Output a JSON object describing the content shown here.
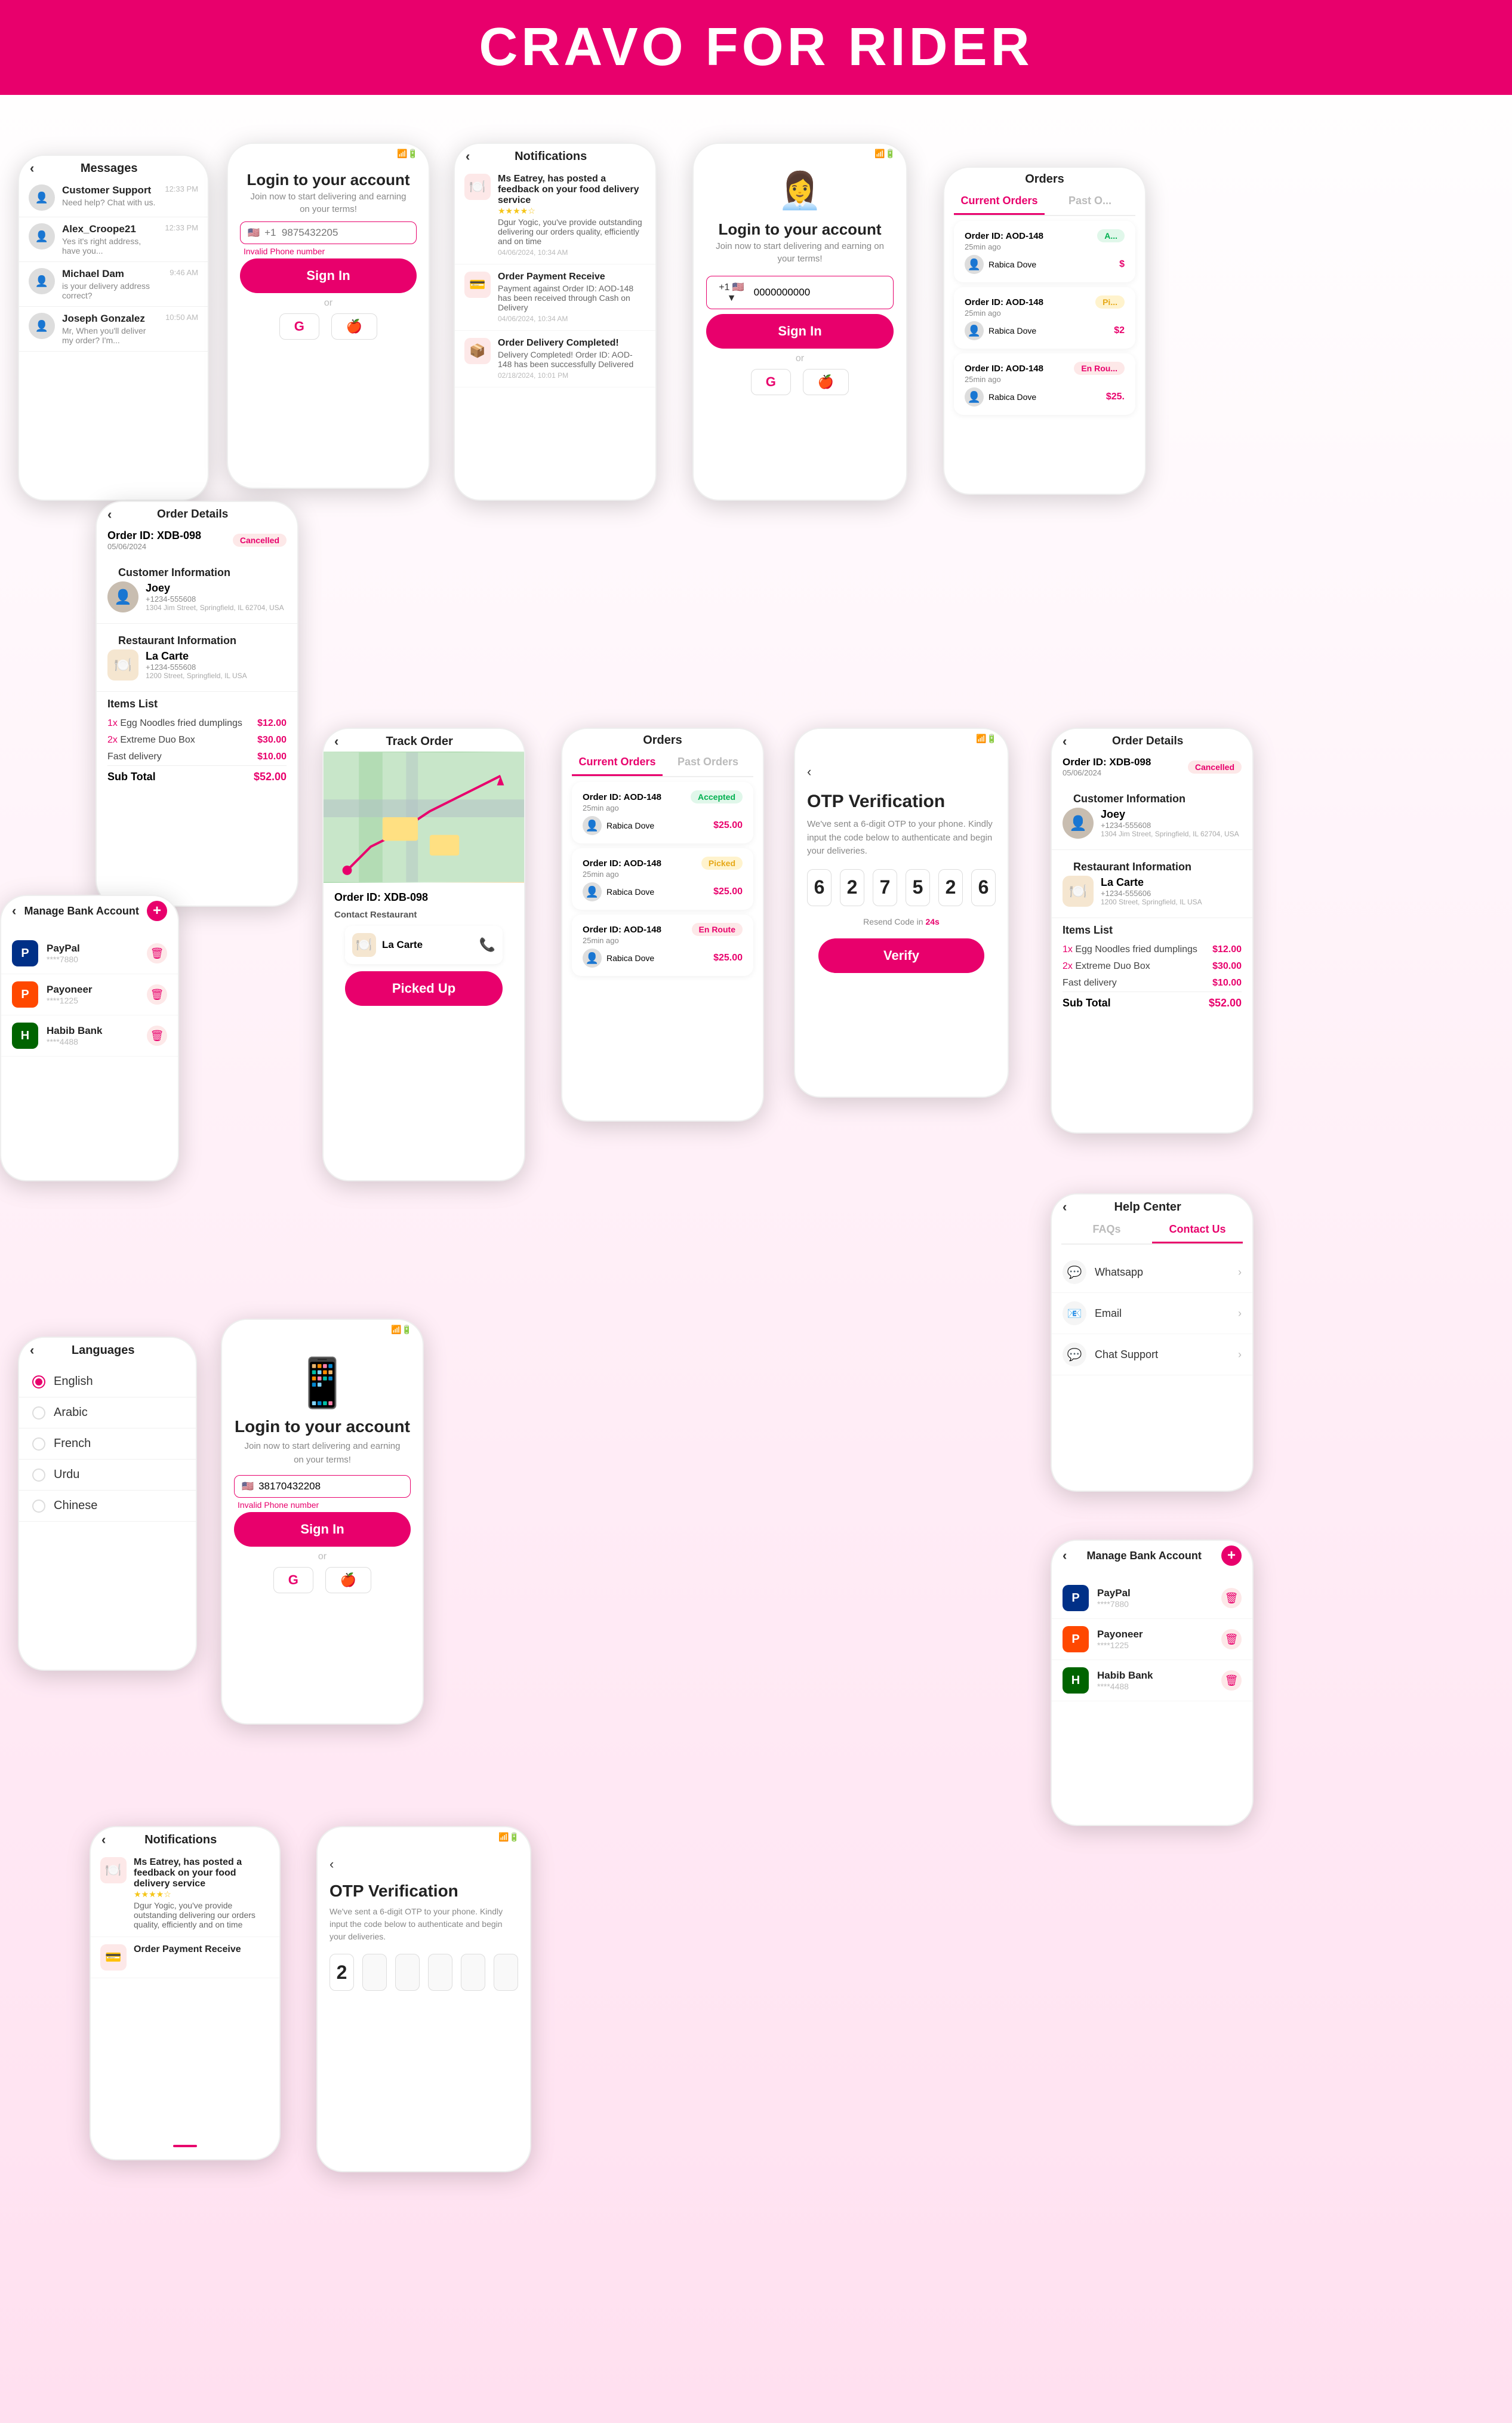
{
  "header": {
    "title": "CRAVO FOR RIDER"
  },
  "screens": {
    "messages": {
      "title": "Messages",
      "items": [
        {
          "name": "Customer Support",
          "text": "Need help? Chat with us.",
          "time": "12:33 PM",
          "avatar": "👤"
        },
        {
          "name": "Alex_Croope21",
          "text": "Yes it's right address, have you...",
          "time": "12:33 PM",
          "avatar": "👤"
        },
        {
          "name": "Michael Dam",
          "text": "is your delivery address correct?",
          "time": "9:46 AM",
          "avatar": "👤"
        },
        {
          "name": "Joseph Gonzalez",
          "text": "Mr, When you'll deliver my order? I'm...",
          "time": "10:50 AM",
          "avatar": "👤"
        }
      ]
    },
    "login1": {
      "title": "Login to your account",
      "subtitle": "Join now to start delivering and earning on your terms!",
      "phone_placeholder": "+1  9875432205",
      "invalid_msg": "Invalid Phone number",
      "sign_in": "Sign In",
      "or": "or",
      "google": "G",
      "apple": ""
    },
    "notifications": {
      "title": "Notifications",
      "items": [
        {
          "icon": "🍽️",
          "title": "Ms Eatrey, has posted a feedback on your food delivery service",
          "stars": 4,
          "text": "Dgur Yogic, you've provide outstanding delivering our orders quality, efficiently and on time",
          "time": "04/06/2024, 10:34 AM"
        },
        {
          "icon": "💳",
          "title": "Order Payment Receive",
          "text": "Payment against Order ID: AOD-148 has been received through Cash on Delivery",
          "time": "04/06/2024, 10:34 AM"
        },
        {
          "icon": "📦",
          "title": "Order Delivery Completed!",
          "text": "Delivery Completed! Order ID: AOD-148 has been successfully Delivered",
          "time": "02/18/2024, 10:01 PM"
        }
      ]
    },
    "login2": {
      "title": "Login to your account",
      "subtitle": "Join now to start delivering and earning on your terms!",
      "phone_placeholder": "0000000000",
      "sign_in": "Sign In",
      "or": "or",
      "google": "G",
      "apple": "",
      "flag": "+1"
    },
    "orders_top": {
      "title": "Orders",
      "tabs": [
        "Current Orders",
        "Past O..."
      ],
      "items": [
        {
          "id": "Order ID: AOD-148",
          "time": "25min ago",
          "customer": "Rabica Dove",
          "price": "$",
          "badge": "A..."
        },
        {
          "id": "Order ID: AOD-148",
          "time": "25min ago",
          "customer": "Rabica Dove",
          "price": "$2",
          "badge": "Pi..."
        },
        {
          "id": "Order ID: AOD-148",
          "time": "25min ago",
          "customer": "Rabica Dove",
          "price": "$25.",
          "badge": "En Rou..."
        }
      ]
    },
    "order_details1": {
      "title": "Order Details",
      "order_id": "Order ID: XDB-098",
      "date": "05/06/2024",
      "badge": "Cancelled",
      "customer_info": "Customer Information",
      "customer_name": "Joey",
      "customer_phone": "+1234-555608",
      "customer_address": "1304 Jim Street, Springfield, IL 62704, USA",
      "restaurant_info": "Restaurant Information",
      "restaurant_name": "La Carte",
      "restaurant_phone": "+1234-555608",
      "restaurant_address": "1200 Street, Springfield, IL USA",
      "items_list": "Items List",
      "items": [
        {
          "qty": "1x",
          "name": "Egg Noodles fried dumplings",
          "price": "$12.00"
        },
        {
          "qty": "2x",
          "name": "Extreme Duo Box",
          "price": "$30.00"
        },
        {
          "name": "Fast delivery",
          "price": "$10.00"
        }
      ],
      "sub_total": "Sub Total",
      "sub_total_price": "$52.00"
    },
    "manage_bank": {
      "title": "Manage Bank Account",
      "accounts": [
        {
          "name": "PayPal",
          "number": "****7880",
          "logo": "P",
          "color": "#003087"
        },
        {
          "name": "Payoneer",
          "number": "****1225",
          "logo": "P",
          "color": "#ff4800"
        },
        {
          "name": "Habib Bank",
          "number": "****4488",
          "logo": "H",
          "color": "#006400"
        }
      ]
    },
    "track_order": {
      "title": "Track Order",
      "order_id": "Order ID: XDB-098",
      "contact_restaurant": "Contact Restaurant",
      "restaurant": "La Carte",
      "picked_up": "Picked Up"
    },
    "orders_mid": {
      "title": "Orders",
      "tabs": [
        "Current Orders",
        "Past Orders"
      ],
      "items": [
        {
          "id": "Order ID: AOD-148",
          "time": "25min ago",
          "customer": "Rabica Dove",
          "price": "$25.00",
          "badge": "Accepted",
          "badge_type": "accepted"
        },
        {
          "id": "Order ID: AOD-148",
          "time": "25min ago",
          "customer": "Rabica Dove",
          "price": "$25.00",
          "badge": "Picked",
          "badge_type": "picked"
        },
        {
          "id": "Order ID: AOD-148",
          "time": "25min ago",
          "customer": "Rabica Dove",
          "price": "$25.00",
          "badge": "En Route",
          "badge_type": "enroute"
        }
      ]
    },
    "otp1": {
      "title": "OTP Verification",
      "desc": "We've sent a 6-digit OTP to your phone. Kindly input the code below to authenticate and begin your deliveries.",
      "digits": [
        "6",
        "2",
        "7",
        "5",
        "2",
        "6"
      ],
      "resend": "Resend Code in",
      "timer": "24s",
      "verify": "Verify"
    },
    "order_details2": {
      "title": "Order Details",
      "order_id": "Order ID: XDB-098",
      "date": "05/06/2024",
      "badge": "Cancelled",
      "customer_name": "Joey",
      "customer_phone": "+1234-555608",
      "customer_address": "1304 Jim Street, Springfield, IL 62704, USA",
      "restaurant_name": "La Carte",
      "restaurant_phone": "+1234-555606",
      "restaurant_address": "1200 Street, Springfield, IL USA",
      "items": [
        {
          "qty": "1x",
          "name": "Egg Noodles fried dumplings",
          "price": "$12.00"
        },
        {
          "qty": "2x",
          "name": "Extreme Duo Box",
          "price": "$30.00"
        },
        {
          "name": "Fast delivery",
          "price": "$10.00"
        }
      ],
      "sub_total": "$52.00"
    },
    "language": {
      "title": "Languages",
      "items": [
        "English",
        "Arabic",
        "French",
        "Urdu",
        "Chinese"
      ]
    },
    "login3": {
      "title": "Login to your account",
      "subtitle": "Join now to start delivering and earning on your terms!",
      "phone_value": "38170432208",
      "invalid_msg": "Invalid Phone number",
      "sign_in": "Sign In",
      "or": "or"
    },
    "help_center": {
      "title": "Help Center",
      "tabs": [
        "FAQs",
        "Contact Us"
      ],
      "items": [
        {
          "icon": "💬",
          "label": "Whatsapp"
        },
        {
          "icon": "📧",
          "label": "Email"
        },
        {
          "icon": "💬",
          "label": "Chat Support"
        }
      ]
    },
    "manage_bank2": {
      "title": "Manage Bank Account",
      "accounts": [
        {
          "name": "PayPal",
          "number": "****7880",
          "logo": "P",
          "color": "#003087"
        },
        {
          "name": "Payoneer",
          "number": "****1225",
          "logo": "P",
          "color": "#ff4800"
        },
        {
          "name": "Habib Bank",
          "number": "****4488",
          "logo": "H",
          "color": "#006400"
        }
      ]
    },
    "notifications2": {
      "title": "Notifications",
      "items": [
        {
          "icon": "🍽️",
          "title": "Ms Eatrey, has posted a feedback on your food delivery service",
          "text": "Dgur Yogic, you've provide outstanding delivering our orders quality, efficiently and on time"
        },
        {
          "icon": "💳",
          "title": "Order Payment Receive",
          "text": ""
        }
      ]
    },
    "otp2": {
      "title": "OTP Verification",
      "desc": "We've sent a 6-digit OTP to your phone. Kindly input the code below to authenticate and begin your deliveries.",
      "digits": [
        "2",
        "",
        "",
        "",
        "",
        ""
      ]
    }
  }
}
